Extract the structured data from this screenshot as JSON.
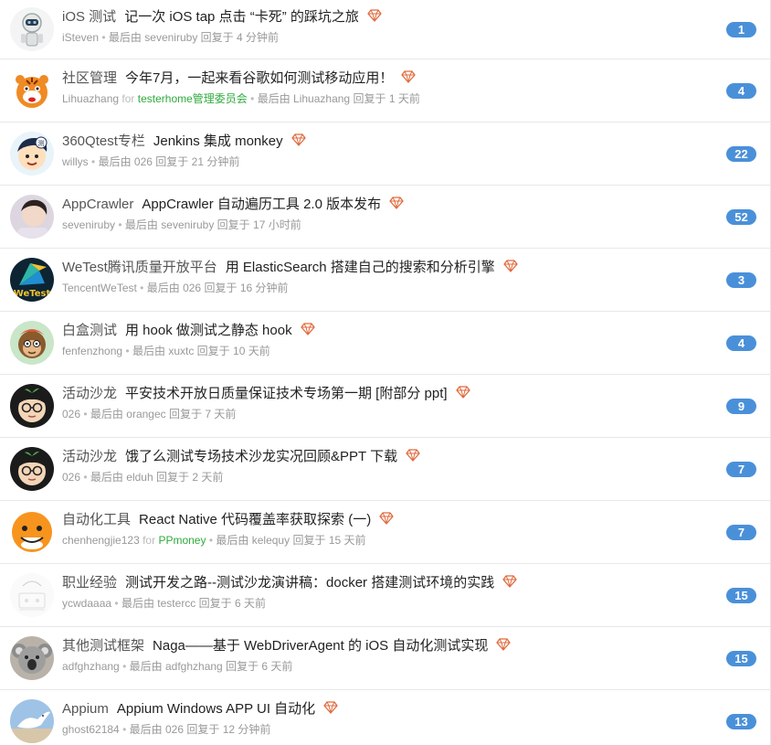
{
  "accent_color": "#4a90d9",
  "team_color": "#2eaa3c",
  "topics": [
    {
      "node": "iOS 测试",
      "title": "记一次 iOS tap 点击 “卡死” 的踩坑之旅",
      "author": "iSteven",
      "team": "",
      "last_reply_by": "seveniruby",
      "time": "4 分钟前",
      "count": "1",
      "avatar": "robot-avatar"
    },
    {
      "node": "社区管理",
      "title": "今年7月，一起来看谷歌如何测试移动应用！",
      "author": "Lihuazhang",
      "team": "testerhome管理委员会",
      "last_reply_by": "Lihuazhang",
      "time": "1 天前",
      "count": "4",
      "avatar": "tiger-avatar"
    },
    {
      "node": "360Qtest专栏",
      "title": "Jenkins 集成 monkey",
      "author": "willys",
      "team": "",
      "last_reply_by": "026",
      "time": "21 分钟前",
      "count": "22",
      "avatar": "cartoon-boy-avatar"
    },
    {
      "node": "AppCrawler",
      "title": "AppCrawler 自动遍历工具 2.0 版本发布",
      "author": "seveniruby",
      "team": "",
      "last_reply_by": "seveniruby",
      "time": "17 小时前",
      "count": "52",
      "avatar": "person-photo-avatar"
    },
    {
      "node": "WeTest腾讯质量开放平台",
      "title": "用 ElasticSearch 搭建自己的搜索和分析引擎",
      "author": "TencentWeTest",
      "team": "",
      "last_reply_by": "026",
      "time": "16 分钟前",
      "count": "3",
      "avatar": "wetest-logo-avatar"
    },
    {
      "node": "白盒测试",
      "title": "用 hook 做测试之静态 hook",
      "author": "fenfenzhong",
      "team": "",
      "last_reply_by": "xuxtc",
      "time": "10 天前",
      "count": "4",
      "avatar": "monkey-avatar"
    },
    {
      "node": "活动沙龙",
      "title": "平安技术开放日质量保证技术专场第一期 [附部分 ppt]",
      "author": "026",
      "team": "",
      "last_reply_by": "orangec",
      "time": "7 天前",
      "count": "9",
      "avatar": "glasses-sprout-avatar"
    },
    {
      "node": "活动沙龙",
      "title": "饿了么测试专场技术沙龙实况回顾&PPT 下载",
      "author": "026",
      "team": "",
      "last_reply_by": "elduh",
      "time": "2 天前",
      "count": "7",
      "avatar": "glasses-sprout-avatar"
    },
    {
      "node": "自动化工具",
      "title": "React Native 代码覆盖率获取探索 (一)",
      "author": "chenhengjie123",
      "team": "PPmoney",
      "last_reply_by": "kelequy",
      "time": "15 天前",
      "count": "7",
      "avatar": "orange-face-avatar"
    },
    {
      "node": "职业经验",
      "title": "测试开发之路--测试沙龙演讲稿：docker 搭建测试环境的实践",
      "author": "ycwdaaaa",
      "team": "",
      "last_reply_by": "testercc",
      "time": "6 天前",
      "count": "15",
      "avatar": "sketch-avatar"
    },
    {
      "node": "其他测试框架",
      "title": "Naga——基于 WebDriverAgent 的 iOS 自动化测试实现",
      "author": "adfghzhang",
      "team": "",
      "last_reply_by": "adfghzhang",
      "time": "6 天前",
      "count": "15",
      "avatar": "koala-avatar"
    },
    {
      "node": "Appium",
      "title": "Appium Windows APP UI 自动化",
      "author": "ghost62184",
      "team": "",
      "last_reply_by": "026",
      "time": "12 分钟前",
      "count": "13",
      "avatar": "dove-avatar"
    }
  ],
  "labels": {
    "for": "for",
    "dot": "•",
    "last_by": "最后由",
    "replied": "回复于"
  }
}
